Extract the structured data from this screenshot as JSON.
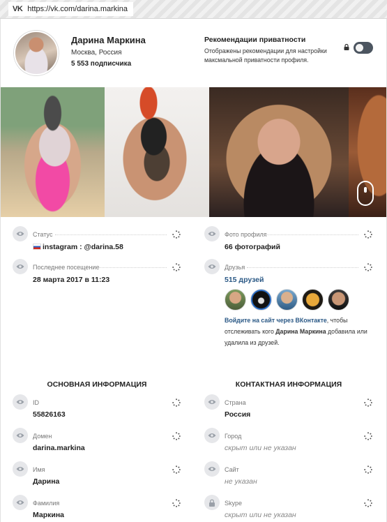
{
  "browser": {
    "url": "https://vk.com/darina.markina",
    "site_logo": "VK"
  },
  "profile": {
    "name": "Дарина Маркина",
    "city": "Москва, Россия",
    "subscribers": "5 553 подписчика"
  },
  "privacy": {
    "title": "Рекомендации приватности",
    "description": "Отображены рекомендации для настройки максмальной приватности профиля.",
    "toggle_on": false
  },
  "photos": [
    "photo-1",
    "photo-2",
    "photo-3",
    "photo-4"
  ],
  "info": {
    "status": {
      "label": "Статус",
      "value": "instagram : @darina.58"
    },
    "last_seen": {
      "label": "Последнее посещение",
      "value": "28 марта 2017 в 11:23"
    },
    "profile_photos": {
      "label": "Фото профиля",
      "value": "66 фотографий"
    },
    "friends": {
      "label": "Друзья",
      "value": "515 друзей"
    }
  },
  "login_note": {
    "link": "Войдите на сайт через ВКонтакте",
    "text1": ", чтобы отслеживать кого ",
    "name": "Дарина Маркина",
    "text2": " добавила или удалила из друзей."
  },
  "sections": {
    "basic_title": "ОСНОВНАЯ ИНФОРМАЦИЯ",
    "contact_title": "КОНТАКТНАЯ ИНФОРМАЦИЯ",
    "basic": [
      {
        "label": "ID",
        "value": "55826163"
      },
      {
        "label": "Домен",
        "value": "darina.markina"
      },
      {
        "label": "Имя",
        "value": "Дарина"
      },
      {
        "label": "Фамилия",
        "value": "Маркина"
      }
    ],
    "contact": [
      {
        "label": "Страна",
        "value": "Россия"
      },
      {
        "label": "Город",
        "value": "скрыт или не указан"
      },
      {
        "label": "Сайт",
        "value": "не указан"
      },
      {
        "label": "Skype",
        "value": "скрыт или не указан"
      }
    ]
  },
  "colors": {
    "link": "#2a5885",
    "toggle": "#4c5560",
    "icon_bg": "#e6e7ea"
  }
}
